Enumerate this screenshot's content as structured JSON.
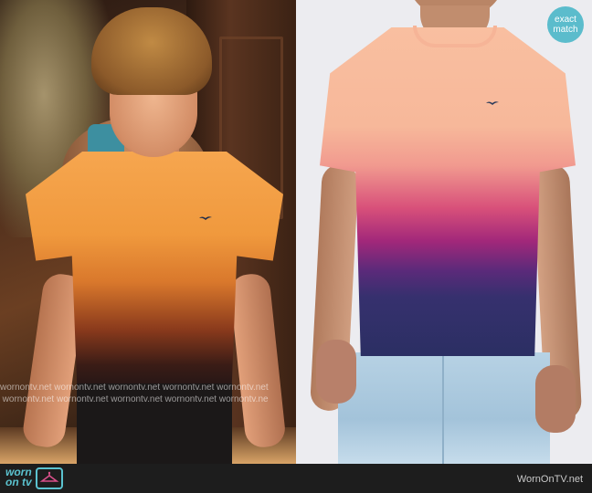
{
  "badge": {
    "line1": "exact",
    "line2": "match",
    "color": "#5bbccc"
  },
  "watermark": {
    "row1": "wornontv.net  wornontv.net  wornontv.net  wornontv.net  wornontv.net",
    "row2": "net  wornontv.net  wornontv.net  wornontv.net  wornontv.net  wornontv.ne"
  },
  "footer": {
    "brand_line1": "worn",
    "brand_line2": "on tv",
    "brand_icon": "tv-hanger-icon",
    "credit": "WornOnTV.net",
    "accent": "#5bc2cf"
  },
  "images": {
    "left": "actor-wearing-orange-ombre-tshirt",
    "right": "product-pink-purple-navy-ombre-tshirt"
  }
}
